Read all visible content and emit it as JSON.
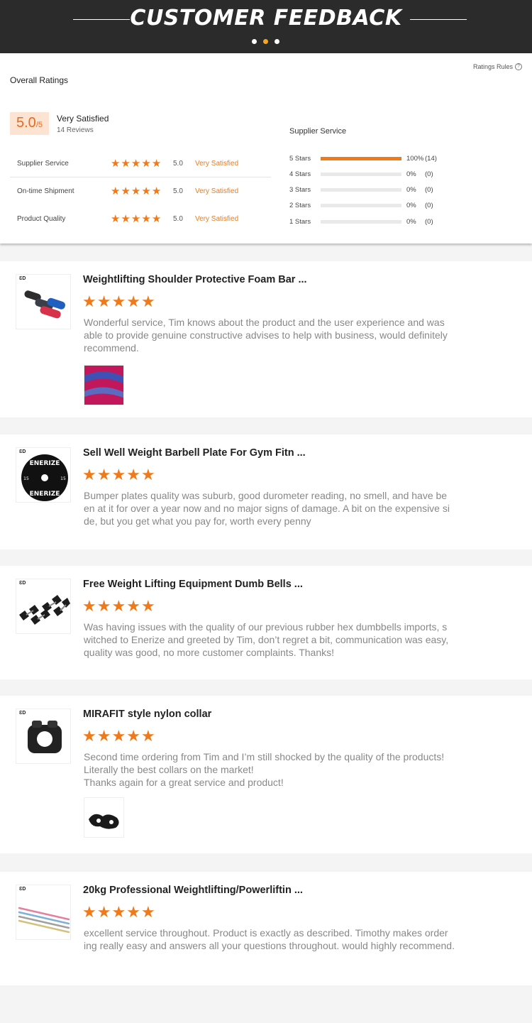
{
  "banner": {
    "title": "CUSTOMER FEEDBACK"
  },
  "summary": {
    "overall_label": "Overall Ratings",
    "rules_link": "Ratings Rules",
    "score": "5.0",
    "score_max": "/5",
    "satisfaction": "Very Satisfied",
    "reviews": "14 Reviews",
    "categories": [
      {
        "name": "Supplier Service",
        "stars": 5,
        "value": "5.0",
        "label": "Very Satisfied"
      },
      {
        "name": "On-time Shipment",
        "stars": 5,
        "value": "5.0",
        "label": "Very Satisfied"
      },
      {
        "name": "Product Quality",
        "stars": 5,
        "value": "5.0",
        "label": "Very Satisfied"
      }
    ],
    "distribution_title": "Supplier Service",
    "distribution": [
      {
        "label": "5 Stars",
        "fraction": 1.0,
        "pct": "100%",
        "count": "(14)"
      },
      {
        "label": "4 Stars",
        "fraction": 0,
        "pct": "0%",
        "count": "(0)"
      },
      {
        "label": "3 Stars",
        "fraction": 0,
        "pct": "0%",
        "count": "(0)"
      },
      {
        "label": "2 Stars",
        "fraction": 0,
        "pct": "0%",
        "count": "(0)"
      },
      {
        "label": "1 Stars",
        "fraction": 0,
        "pct": "0%",
        "count": "(0)"
      }
    ]
  },
  "reviews": [
    {
      "title": "Weightlifting Shoulder Protective Foam Bar ...",
      "stars": 5,
      "text": "Wonderful service, Tim knows about the product and the user experience and was\nable to provide genuine constructive advises to help with business, would definitely\nrecommend.",
      "thumb_icon": "foam-pads-icon",
      "photo_icon": "foam-photo-icon"
    },
    {
      "title": "Sell Well Weight Barbell Plate For Gym Fitn ...",
      "stars": 5,
      "text": "Bumper plates quality was suburb, good durometer reading, no smell, and have be\nen at it for over a year now and no major signs of damage. A bit on the expensive si\nde, but you get what you pay for, worth every penny",
      "thumb_icon": "bumper-plate-icon",
      "plate_text": "ENERIZE",
      "plate_weight": "15"
    },
    {
      "title": "Free Weight Lifting Equipment Dumb Bells ...",
      "stars": 5,
      "text": "Was having issues with the quality of our previous rubber hex dumbbells imports, s\nwitched to Enerize and greeted by Tim, don’t regret a bit, communication was easy,\nquality was good, no more customer complaints. Thanks!",
      "thumb_icon": "dumbbells-icon"
    },
    {
      "title": "MIRAFIT style nylon collar",
      "stars": 5,
      "text": "Second time ordering from Tim and I’m still shocked by the quality of the products!\nLiterally the best collars on the market!\nThanks again for a great service and product!",
      "thumb_icon": "collar-icon",
      "photo_icon": "collar-photo-icon"
    },
    {
      "title": "20kg Professional Weightlifting/Powerliftin ...",
      "stars": 5,
      "text": "excellent service throughout. Product is exactly as described. Timothy makes order\ning really easy and answers all your questions throughout. would highly recommend.",
      "thumb_icon": "barbell-icon"
    }
  ],
  "colors": {
    "accent": "#f07a1a",
    "banner": "#2b2b2b",
    "score_bg": "#fde3d2"
  }
}
